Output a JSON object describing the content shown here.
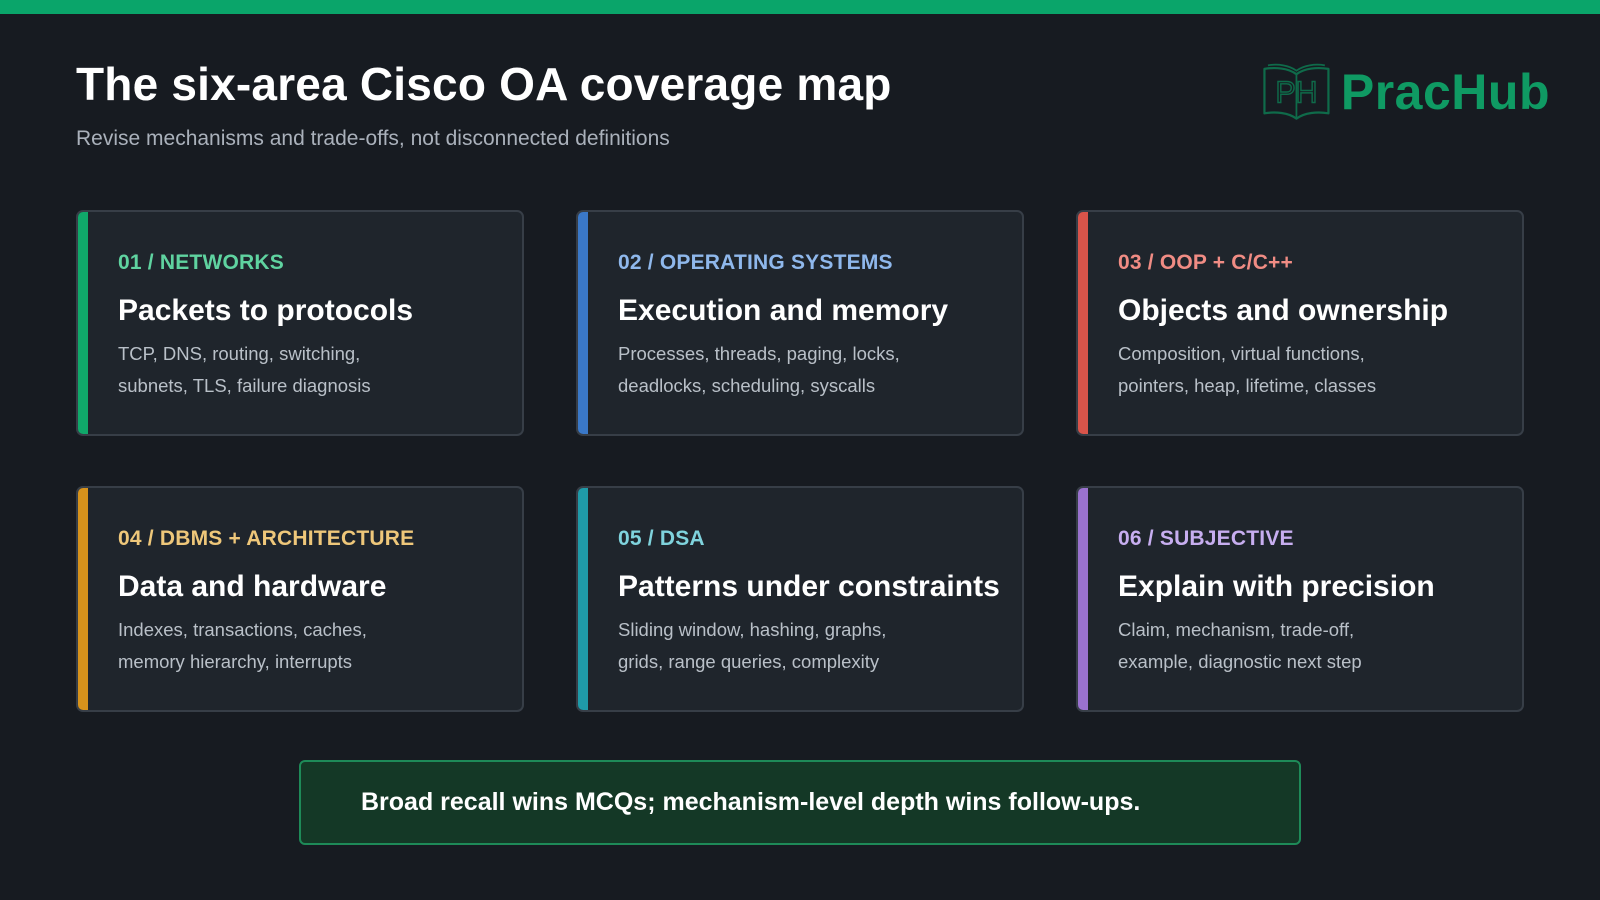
{
  "header": {
    "title": "The six-area Cisco OA coverage map",
    "subtitle": "Revise mechanisms and trade-offs, not disconnected definitions"
  },
  "logo": {
    "mark_text": "PH",
    "brand": "PracHub",
    "icon": "open-book-icon",
    "color": "#0f9a63"
  },
  "colors": {
    "top_bar": "#0aa56a",
    "background": "#171b21"
  },
  "cards": [
    {
      "label": "01 / NETWORKS",
      "heading": "Packets to protocols",
      "description": "TCP, DNS, routing, switching, subnets, TLS, failure diagnosis",
      "accent_color": "#10a86a",
      "label_color": "#5fd3a0"
    },
    {
      "label": "02 / OPERATING SYSTEMS",
      "heading": "Execution and memory",
      "description": "Processes, threads, paging, locks, deadlocks, scheduling, syscalls",
      "accent_color": "#3a78c8",
      "label_color": "#8fb8ec"
    },
    {
      "label": "03 / OOP + C/C++",
      "heading": "Objects and ownership",
      "description": "Composition, virtual functions, pointers, heap, lifetime, classes",
      "accent_color": "#d9544a",
      "label_color": "#f08c84"
    },
    {
      "label": "04 / DBMS + ARCHITECTURE",
      "heading": "Data and hardware",
      "description": "Indexes, transactions, caches, memory hierarchy, interrupts",
      "accent_color": "#d6921c",
      "label_color": "#eec77a"
    },
    {
      "label": "05 / DSA",
      "heading": "Patterns under constraints",
      "description": "Sliding window, hashing, graphs, grids, range queries, complexity",
      "accent_color": "#1f9aa8",
      "label_color": "#7fd3dd"
    },
    {
      "label": "06 / SUBJECTIVE",
      "heading": "Explain with precision",
      "description": "Claim, mechanism, trade-off, example, diagnostic next step",
      "accent_color": "#9a72cf",
      "label_color": "#c7aef0"
    }
  ],
  "callout": {
    "text": "Broad recall wins MCQs; mechanism-level depth wins follow-ups."
  }
}
